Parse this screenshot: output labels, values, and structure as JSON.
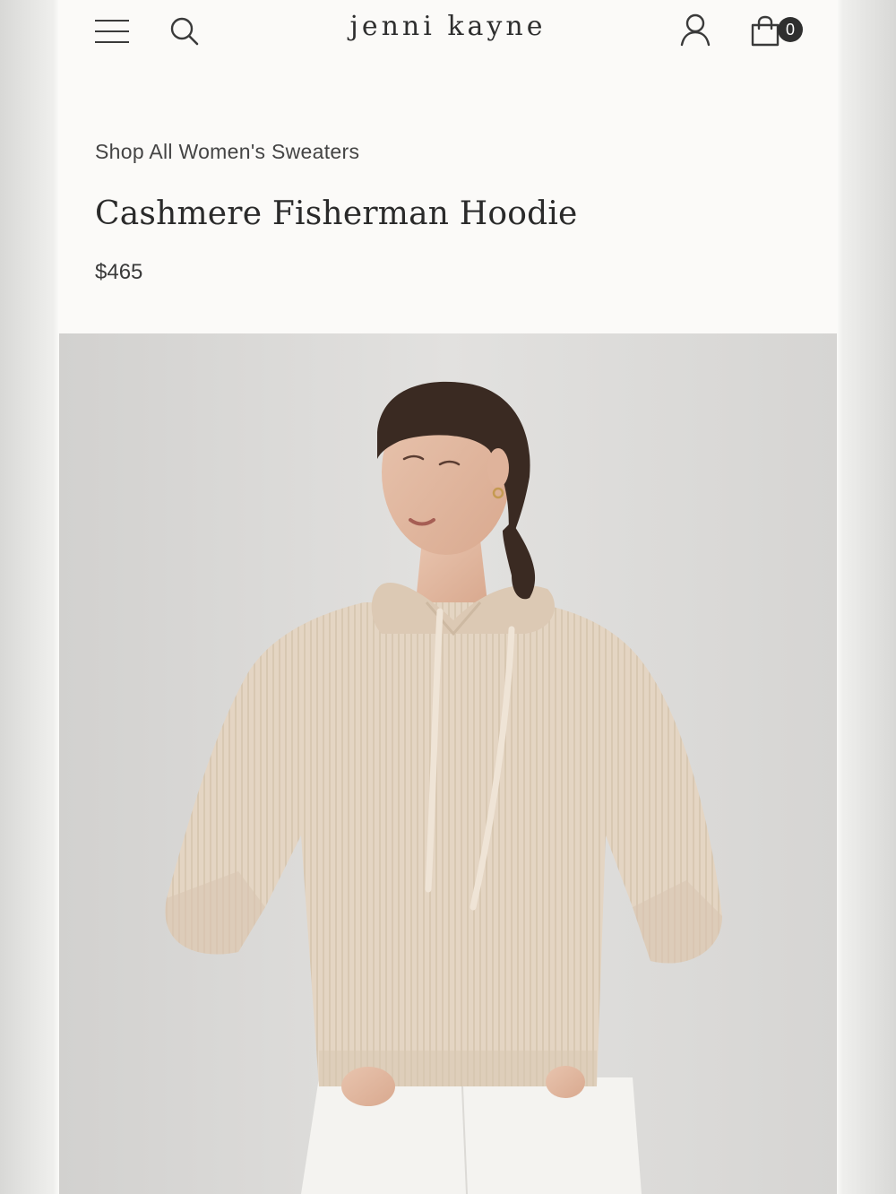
{
  "header": {
    "logo_text": "jenni kayne",
    "cart_count": "0",
    "icons": {
      "menu": "hamburger-menu-icon",
      "search": "search-icon",
      "account": "user-icon",
      "cart": "shopping-bag-icon"
    }
  },
  "product": {
    "breadcrumb": "Shop All Women's Sweaters",
    "title": "Cashmere Fisherman Hoodie",
    "price": "$465"
  },
  "colors": {
    "page_background": "#fbfaf8",
    "image_background": "#dddcda",
    "sweater": "#e3d3c0",
    "badge": "#2f2f2f"
  }
}
